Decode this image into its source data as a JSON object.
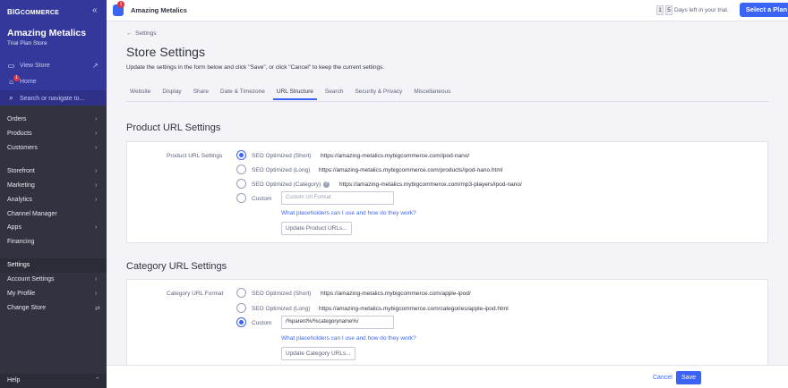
{
  "sidebar": {
    "logo_prefix": "BIG",
    "logo_suffix": "COMMERCE",
    "collapse_icon": "«",
    "store_name": "Amazing Metalics",
    "store_plan": "Trial Plan Store",
    "view_store": "View Store",
    "home": "Home",
    "home_badge": "1",
    "search_placeholder": "Search or navigate to...",
    "nav": [
      "Orders",
      "Products",
      "Customers",
      "Storefront",
      "Marketing",
      "Analytics",
      "Channel Manager",
      "Apps",
      "Financing",
      "Settings",
      "Account Settings",
      "My Profile",
      "Change Store"
    ],
    "help": "Help"
  },
  "topbar": {
    "badge": "1",
    "store_name": "Amazing Metalics",
    "trial_digit1": "1",
    "trial_digit2": "5",
    "trial_text": "Days left in your trial.",
    "select_plan": "Select a Plan"
  },
  "page": {
    "back": "Settings",
    "title": "Store Settings",
    "subtitle": "Update the settings in the form below and click \"Save\", or click \"Cancel\" to keep the current settings.",
    "tabs": [
      "Website",
      "Display",
      "Share",
      "Date & Timezone",
      "URL Structure",
      "Search",
      "Security & Privacy",
      "Miscellaneous"
    ],
    "active_tab": "URL Structure"
  },
  "product": {
    "title": "Product URL Settings",
    "label": "Product URL Settings",
    "options": [
      {
        "label": "SEO Optimized (Short)",
        "url": "https://amazing-metalics.mybigcommerce.com/ipod-nano/",
        "selected": true
      },
      {
        "label": "SEO Optimized (Long)",
        "url": "https://amazing-metalics.mybigcommerce.com/products/ipod-nano.html",
        "selected": false
      },
      {
        "label": "SEO Optimized (Category)",
        "url": "https://amazing-metalics.mybigcommerce.com/mp3-players/ipod-nano/",
        "selected": false
      },
      {
        "label": "Custom",
        "url": "",
        "selected": false
      }
    ],
    "custom_placeholder": "Custom Url Format",
    "help_link": "What placeholders can I use and how do they work?",
    "update_button": "Update Product URLs..."
  },
  "category": {
    "title": "Category URL Settings",
    "label": "Category URL Format",
    "options": [
      {
        "label": "SEO Optimized (Short)",
        "url": "https://amazing-metalics.mybigcommerce.com/apple-ipod/",
        "selected": false
      },
      {
        "label": "SEO Optimized (Long)",
        "url": "https://amazing-metalics.mybigcommerce.com/categories/apple-ipod.html",
        "selected": false
      },
      {
        "label": "Custom",
        "url": "",
        "selected": true
      }
    ],
    "custom_value": "/%parent%/%categoryname%/",
    "help_link": "What placeholders can I use and how do they work?",
    "update_button": "Update Category URLs..."
  },
  "footer": {
    "cancel": "Cancel",
    "save": "Save"
  },
  "colors": {
    "accent": "#3c64f4",
    "sidebar": "#313440",
    "sidebar_header": "#34389a"
  }
}
